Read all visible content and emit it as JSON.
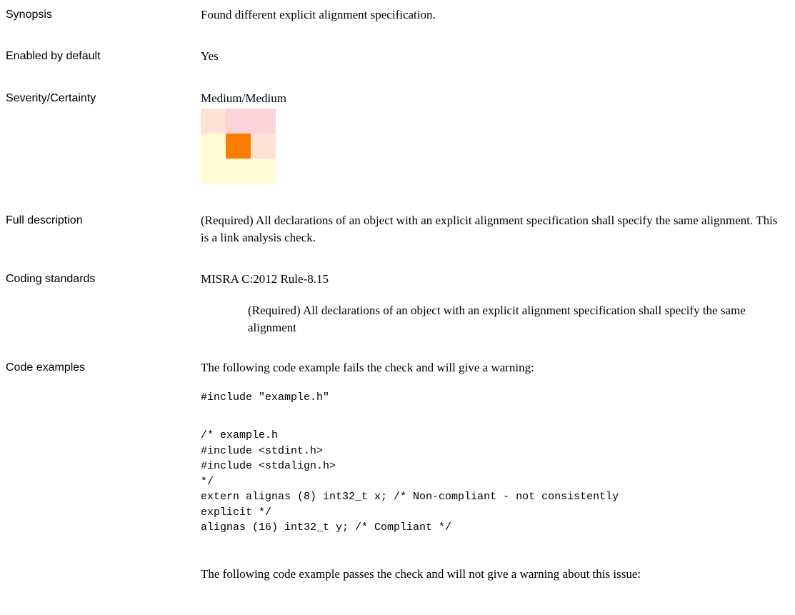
{
  "synopsis": {
    "label": "Synopsis",
    "text": "Found different explicit alignment specification."
  },
  "enabled": {
    "label": "Enabled by default",
    "text": "Yes"
  },
  "severity": {
    "label": "Severity/Certainty",
    "text": "Medium/Medium",
    "matrix_colors": [
      [
        "#fde3d6",
        "#fbd3d8",
        "#fbd3d8"
      ],
      [
        "#fffcd6",
        "#fa7d00",
        "#fde3d6"
      ],
      [
        "#fffcd6",
        "#fffcd6",
        "#fffcd6"
      ]
    ]
  },
  "full_description": {
    "label": "Full description",
    "text": " (Required) All declarations of an object with an explicit alignment specification shall specify the same alignment. This is a link analysis check."
  },
  "coding_standards": {
    "label": "Coding standards",
    "standard": "MISRA C:2012 Rule-8.15",
    "detail": "(Required) All declarations of an object with an explicit alignment specification shall specify the same alignment"
  },
  "code_examples": {
    "label": "Code examples",
    "fail_intro": "The following code example fails the check and will give a warning:",
    "fail_code_1": "#include \"example.h\"",
    "fail_code_2": "/* example.h\n#include <stdint.h>\n#include <stdalign.h>\n*/\nextern alignas (8) int32_t x; /* Non-compliant - not consistently\nexplicit */\nalignas (16) int32_t y; /* Compliant */",
    "pass_intro": "The following code example passes the check and will not give a warning about this issue:"
  }
}
